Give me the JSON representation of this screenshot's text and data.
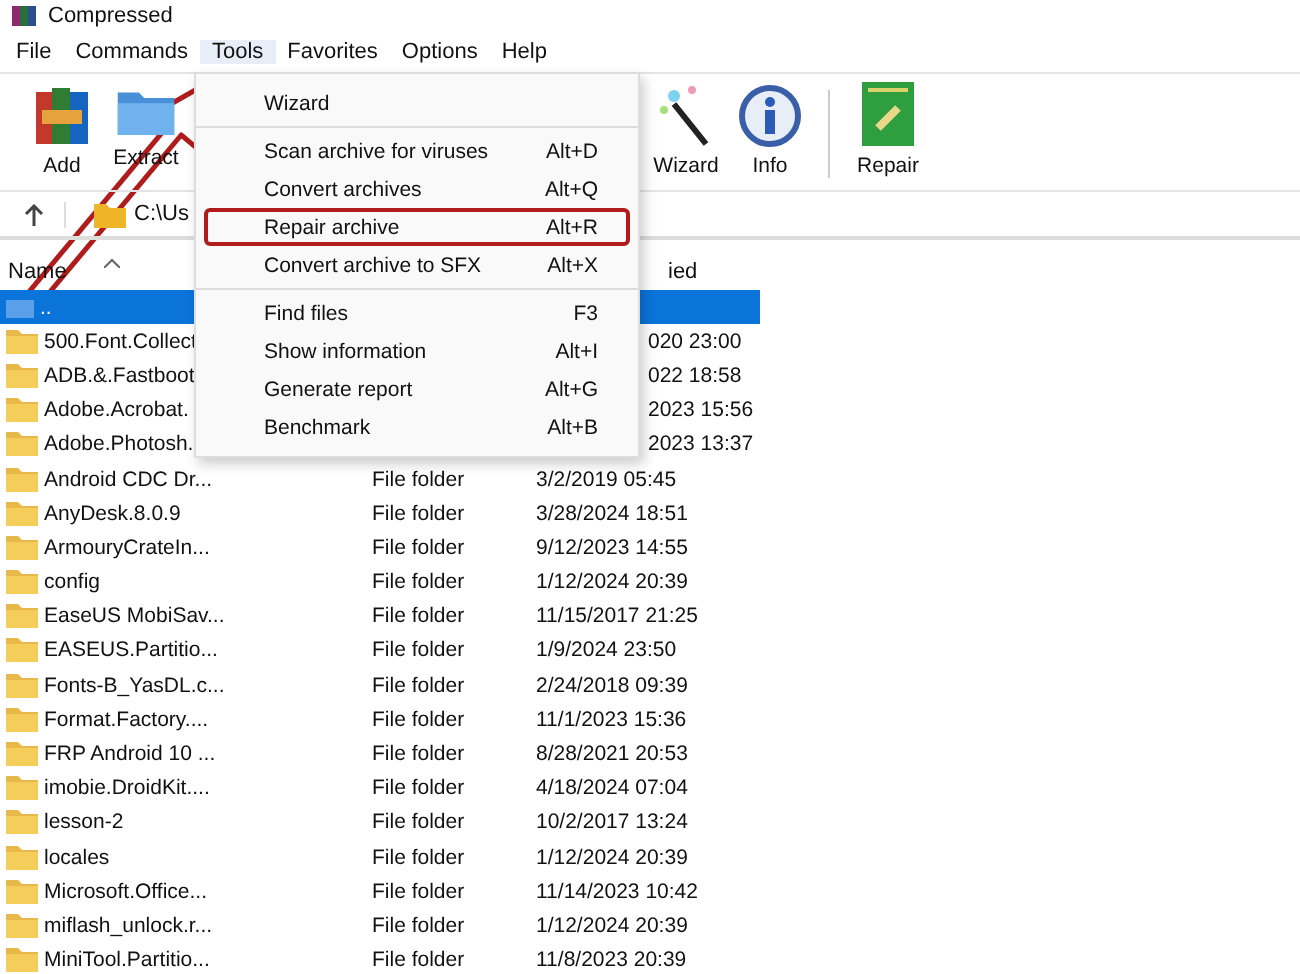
{
  "window": {
    "title": "Compressed"
  },
  "menu_bar": [
    {
      "label": "File",
      "selected": false
    },
    {
      "label": "Commands",
      "selected": false
    },
    {
      "label": "Tools",
      "selected": true
    },
    {
      "label": "Favorites",
      "selected": false
    },
    {
      "label": "Options",
      "selected": false
    },
    {
      "label": "Help",
      "selected": false
    }
  ],
  "toolbar": {
    "groups": [
      [
        {
          "label": "Add"
        },
        {
          "label": "Extract"
        }
      ],
      [
        {
          "label": "Wizard"
        },
        {
          "label": "Info"
        }
      ],
      [
        {
          "label": "Repair"
        }
      ]
    ]
  },
  "address_bar": {
    "path": "C:\\Us"
  },
  "columns": [
    {
      "label": "Name",
      "sorted": true
    },
    {
      "label": "ied"
    }
  ],
  "rows": [
    {
      "name": "..",
      "type": "",
      "modified": "",
      "selected": true,
      "kind": "up"
    },
    {
      "name": "500.Font.Collect",
      "type": "",
      "modified": "020 23:00",
      "selected": false,
      "kind": "folder"
    },
    {
      "name": "ADB.&.Fastboot",
      "type": "",
      "modified": "022 18:58",
      "selected": false,
      "kind": "folder"
    },
    {
      "name": "Adobe.Acrobat.",
      "type": "",
      "modified": "2023 15:56",
      "selected": false,
      "kind": "folder"
    },
    {
      "name": "Adobe.Photosh.",
      "type": "",
      "modified": "2023 13:37",
      "selected": false,
      "kind": "folder"
    },
    {
      "name": "Android CDC Dr...",
      "type": "File folder",
      "modified": "3/2/2019 05:45",
      "selected": false,
      "kind": "folder"
    },
    {
      "name": "AnyDesk.8.0.9",
      "type": "File folder",
      "modified": "3/28/2024 18:51",
      "selected": false,
      "kind": "folder"
    },
    {
      "name": "ArmouryCrateIn...",
      "type": "File folder",
      "modified": "9/12/2023 14:55",
      "selected": false,
      "kind": "folder"
    },
    {
      "name": "config",
      "type": "File folder",
      "modified": "1/12/2024 20:39",
      "selected": false,
      "kind": "folder"
    },
    {
      "name": "EaseUS MobiSav...",
      "type": "File folder",
      "modified": "11/15/2017 21:25",
      "selected": false,
      "kind": "folder"
    },
    {
      "name": "EASEUS.Partitio...",
      "type": "File folder",
      "modified": "1/9/2024 23:50",
      "selected": false,
      "kind": "folder"
    },
    {
      "name": "Fonts-B_YasDL.c...",
      "type": "File folder",
      "modified": "2/24/2018 09:39",
      "selected": false,
      "kind": "folder"
    },
    {
      "name": "Format.Factory....",
      "type": "File folder",
      "modified": "11/1/2023 15:36",
      "selected": false,
      "kind": "folder"
    },
    {
      "name": "FRP Android 10 ...",
      "type": "File folder",
      "modified": "8/28/2021 20:53",
      "selected": false,
      "kind": "folder"
    },
    {
      "name": "imobie.DroidKit....",
      "type": "File folder",
      "modified": "4/18/2024 07:04",
      "selected": false,
      "kind": "folder"
    },
    {
      "name": "lesson-2",
      "type": "File folder",
      "modified": "10/2/2017 13:24",
      "selected": false,
      "kind": "folder"
    },
    {
      "name": "locales",
      "type": "File folder",
      "modified": "1/12/2024 20:39",
      "selected": false,
      "kind": "folder"
    },
    {
      "name": "Microsoft.Office...",
      "type": "File folder",
      "modified": "11/14/2023 10:42",
      "selected": false,
      "kind": "folder"
    },
    {
      "name": "miflash_unlock.r...",
      "type": "File folder",
      "modified": "1/12/2024 20:39",
      "selected": false,
      "kind": "folder"
    },
    {
      "name": "MiniTool.Partitio...",
      "type": "File folder",
      "modified": "11/8/2023 20:39",
      "selected": false,
      "kind": "folder"
    }
  ],
  "tools_menu": {
    "groups": [
      [
        {
          "label": "Wizard",
          "highlighted": false
        }
      ],
      [
        {
          "label": "Scan archive for viruses",
          "shortcut": "Alt+D",
          "highlighted": false
        },
        {
          "label": "Convert archives",
          "shortcut": "Alt+Q",
          "highlighted": false
        },
        {
          "label": "Repair archive",
          "shortcut": "Alt+R",
          "highlighted": true
        },
        {
          "label": "Convert archive to SFX",
          "shortcut": "Alt+X",
          "highlighted": false
        }
      ],
      [
        {
          "label": "Find files",
          "shortcut": "F3",
          "highlighted": false
        },
        {
          "label": "Show information",
          "shortcut": "Alt+I",
          "highlighted": false
        },
        {
          "label": "Generate report",
          "shortcut": "Alt+G",
          "highlighted": false
        },
        {
          "label": "Benchmark",
          "shortcut": "Alt+B",
          "highlighted": false
        }
      ]
    ]
  },
  "annotation": {
    "arrow": true
  }
}
